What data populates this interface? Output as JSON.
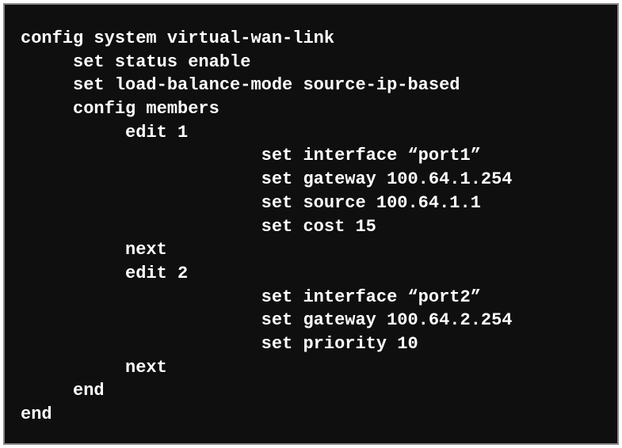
{
  "cli": {
    "lines": {
      "l0": "config system virtual-wan-link",
      "l1": "     set status enable",
      "l2": "     set load-balance-mode source-ip-based",
      "l3": "     config members",
      "l4": "          edit 1",
      "l5": "                       set interface “port1”",
      "l6": "                       set gateway 100.64.1.254",
      "l7": "                       set source 100.64.1.1",
      "l8": "                       set cost 15",
      "l9": "          next",
      "l10": "          edit 2",
      "l11": "                       set interface “port2”",
      "l12": "                       set gateway 100.64.2.254",
      "l13": "                       set priority 10",
      "l14": "          next",
      "l15": "     end",
      "l16": "end"
    }
  }
}
